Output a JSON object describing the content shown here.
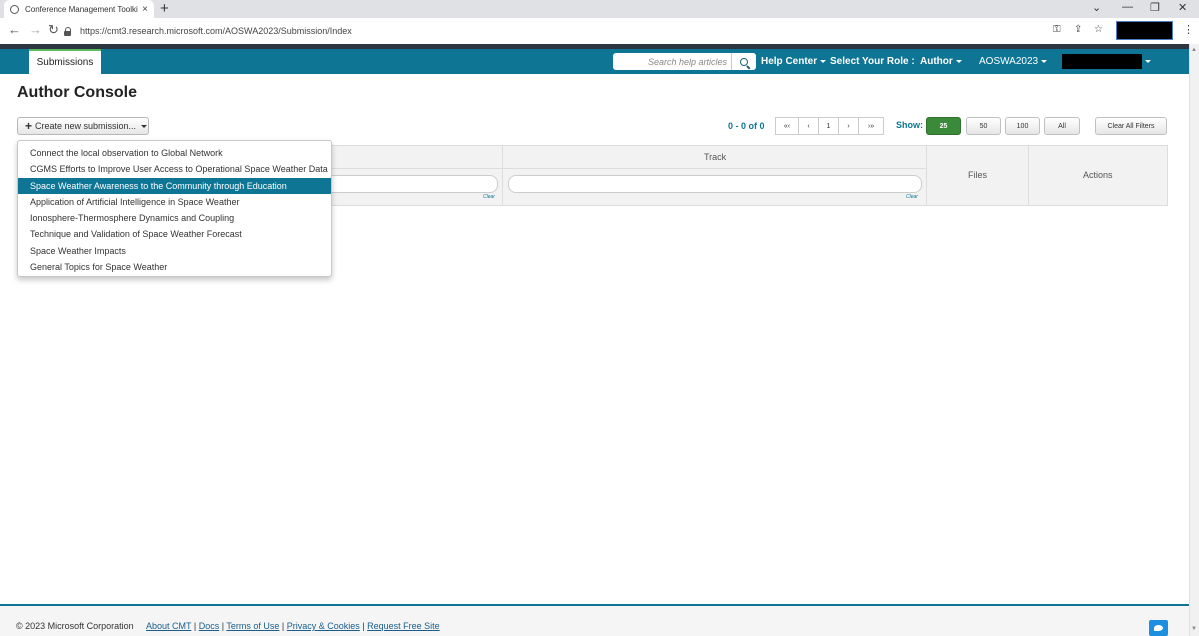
{
  "browser": {
    "tab_title": "Conference Management Toolkit",
    "tab_close": "×",
    "new_tab": "+",
    "url": "https://cmt3.research.microsoft.com/AOSWA2023/Submission/Index",
    "back": "←",
    "forward": "→",
    "reload": "↻",
    "key_icon": "⚿",
    "share_icon": "⇪",
    "star_icon": "☆",
    "kebab": "⋮",
    "win_chevron": "⌄",
    "win_min": "—",
    "win_restore": "❐",
    "win_close": "✕"
  },
  "header": {
    "nav_tab": "Submissions",
    "search_placeholder": "Search help articles",
    "help_center": "Help Center",
    "role_label": "Select Your Role :",
    "role_value": "Author",
    "conference": "AOSWA2023"
  },
  "page": {
    "title": "Author Console",
    "create_button": "Create new submission..."
  },
  "pager": {
    "info": "0 - 0 of 0",
    "first": "«‹",
    "prev": "‹",
    "current": "1",
    "next": "›",
    "last": "›»",
    "show_label": "Show:",
    "sizes": [
      "25",
      "50",
      "100",
      "All"
    ],
    "clear_all": "Clear All Filters"
  },
  "table": {
    "columns": [
      "Track",
      "Files",
      "Actions"
    ],
    "clear": "Clear"
  },
  "dropdown": {
    "items": [
      "Connect the local observation to Global Network",
      "CGMS Efforts to Improve User Access to Operational Space Weather Data",
      "Space Weather Awareness to the Community through Education",
      "Application of Artificial Intelligence in Space Weather",
      "Ionosphere-Thermosphere Dynamics and Coupling",
      "Technique and Validation of Space Weather Forecast",
      "Space Weather Impacts",
      "General Topics for Space Weather"
    ],
    "highlighted_index": 2
  },
  "footer": {
    "copyright": "© 2023 Microsoft Corporation",
    "links": [
      "About CMT",
      "Docs",
      "Terms of Use",
      "Privacy & Cookies",
      "Request Free Site"
    ],
    "separator": " | "
  },
  "colors": {
    "brand": "#0e7595",
    "active_size": "#3a8a3a"
  }
}
